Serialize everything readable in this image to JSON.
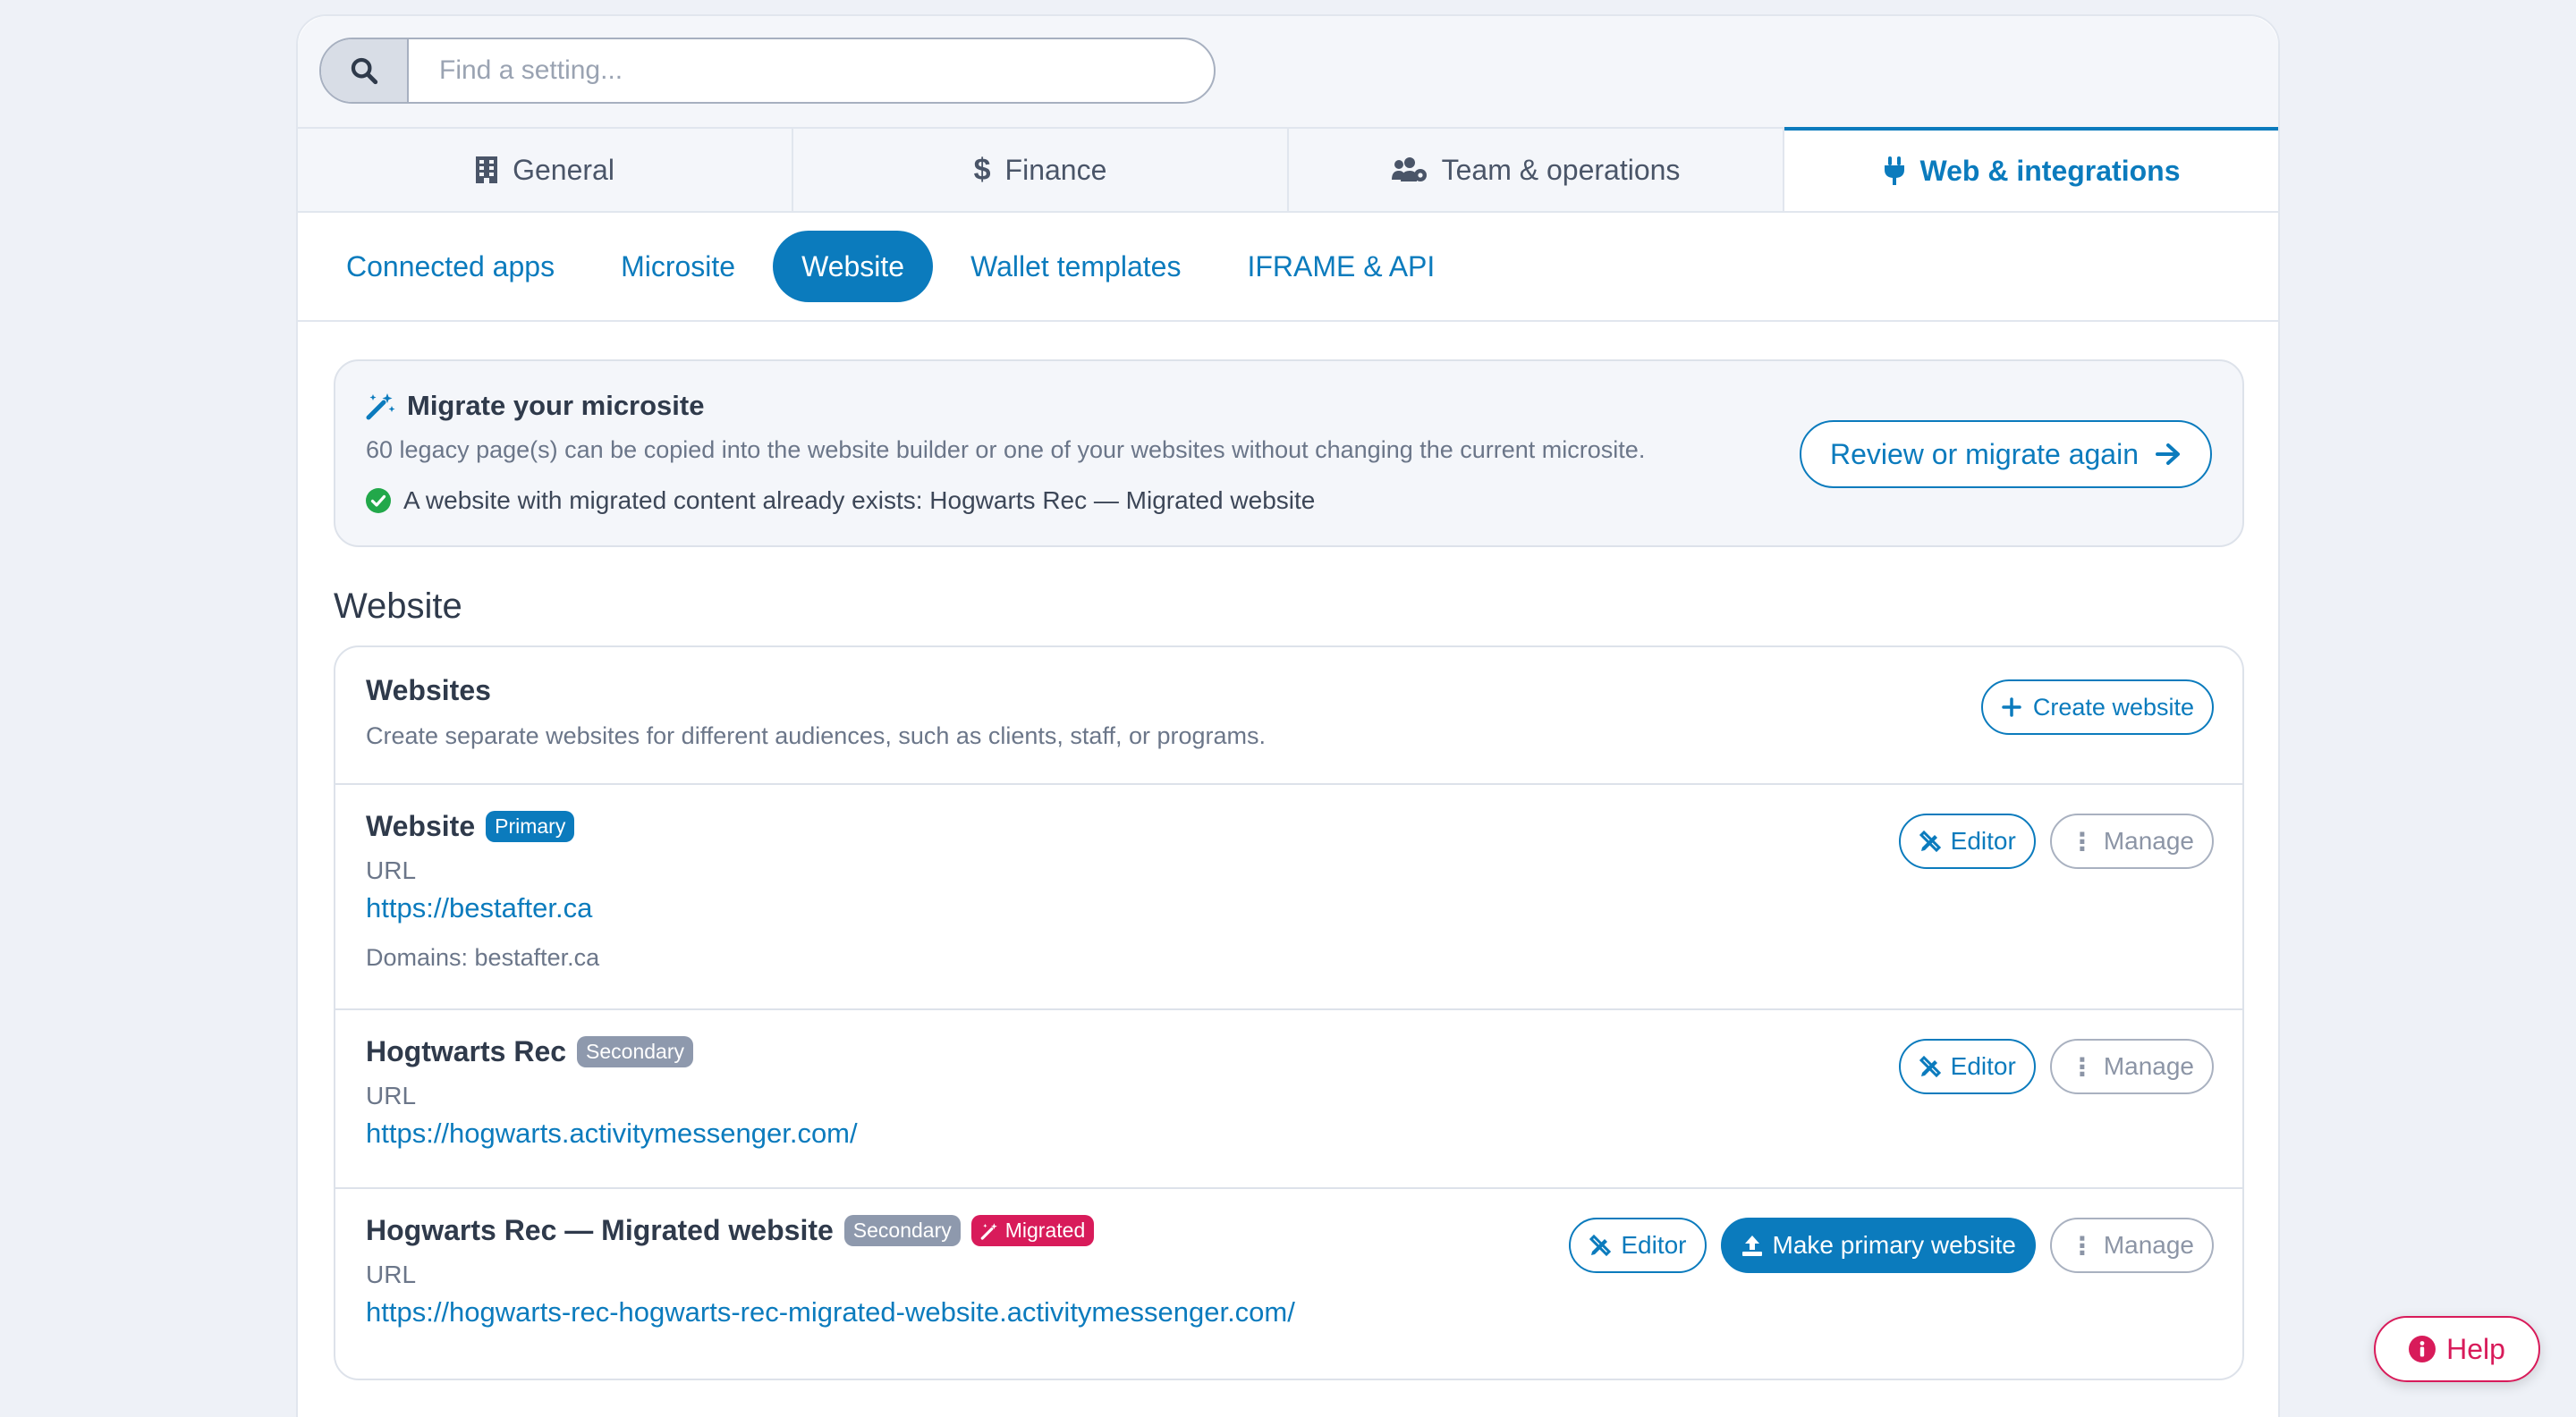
{
  "search": {
    "placeholder": "Find a setting..."
  },
  "main_tabs": [
    {
      "label": "General",
      "icon": "building-icon"
    },
    {
      "label": "Finance",
      "icon": "dollar-icon"
    },
    {
      "label": "Team & operations",
      "icon": "users-cog-icon"
    },
    {
      "label": "Web & integrations",
      "icon": "plug-icon",
      "active": true
    }
  ],
  "sub_tabs": [
    {
      "label": "Connected apps"
    },
    {
      "label": "Microsite"
    },
    {
      "label": "Website",
      "active": true
    },
    {
      "label": "Wallet templates"
    },
    {
      "label": "IFRAME & API"
    }
  ],
  "migrate": {
    "title": "Migrate your microsite",
    "description": "60 legacy page(s) can be copied into the website builder or one of your websites without changing the current microsite.",
    "status": "A website with migrated content already exists: Hogwarts Rec — Migrated website",
    "button": "Review or migrate again"
  },
  "section_title": "Website",
  "websites_card": {
    "title": "Websites",
    "description": "Create separate websites for different audiences, such as clients, staff, or programs.",
    "create_button": "Create website"
  },
  "sites": [
    {
      "name": "Website",
      "badges": [
        "Primary"
      ],
      "url_label": "URL",
      "url": "https://bestafter.ca",
      "domains": "Domains: bestafter.ca",
      "editor_label": "Editor",
      "manage_label": "Manage"
    },
    {
      "name": "Hogtwarts Rec",
      "badges": [
        "Secondary"
      ],
      "url_label": "URL",
      "url": "https://hogwarts.activitymessenger.com/",
      "editor_label": "Editor",
      "manage_label": "Manage"
    },
    {
      "name": "Hogwarts Rec — Migrated website",
      "badges": [
        "Secondary",
        "Migrated"
      ],
      "url_label": "URL",
      "url": "https://hogwarts-rec-hogwarts-rec-migrated-website.activitymessenger.com/",
      "editor_label": "Editor",
      "make_primary_label": "Make primary website",
      "manage_label": "Manage"
    }
  ],
  "help": {
    "label": "Help"
  },
  "colors": {
    "accent": "#0b7bbd",
    "danger": "#d81b5a",
    "success": "#22a84a",
    "muted": "#8e99ad"
  }
}
